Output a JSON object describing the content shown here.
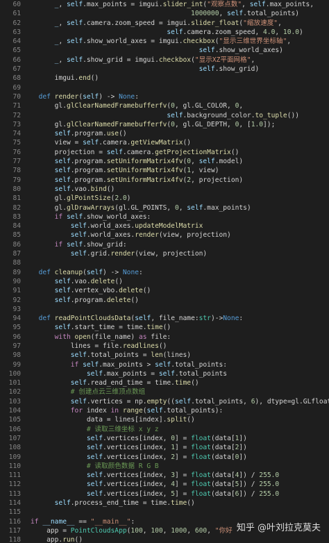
{
  "watermark": "知乎 @叶刘拉克莫夫",
  "lines": [
    {
      "n": "60",
      "html": "      <span class='self'>_</span>, <span class='self'>self</span>.max_points = imgui.<span class='fn'>slider_int</span>(<span class='str'>\"观察点数\"</span>, <span class='self'>self</span>.max_points,"
    },
    {
      "n": "61",
      "html": "                                        <span class='num'>1000000</span>, <span class='self'>self</span>.total_points)"
    },
    {
      "n": "62",
      "html": "      <span class='self'>_</span>, <span class='self'>self</span>.camera.zoom_speed = imgui.<span class='fn'>slider_float</span>(<span class='str'>\"缩放速度\"</span>,"
    },
    {
      "n": "63",
      "html": "                                  <span class='self'>self</span>.camera.zoom_speed, <span class='num'>4.0</span>, <span class='num'>10.0</span>)"
    },
    {
      "n": "64",
      "html": "      <span class='self'>_</span>, <span class='self'>self</span>.show_world_axes = imgui.<span class='fn'>checkbox</span>(<span class='str'>\"显示三维世界坐标轴\"</span>,"
    },
    {
      "n": "65",
      "html": "                                          <span class='self'>self</span>.show_world_axes)"
    },
    {
      "n": "66",
      "html": "      <span class='self'>_</span>, <span class='self'>self</span>.show_grid = imgui.<span class='fn'>checkbox</span>(<span class='str'>\"显示XZ平面网格\"</span>,"
    },
    {
      "n": "67",
      "html": "                                          <span class='self'>self</span>.show_grid)"
    },
    {
      "n": "68",
      "html": "      imgui.<span class='fn'>end</span>()"
    },
    {
      "n": "69",
      "html": ""
    },
    {
      "n": "70",
      "html": "  <span class='kw'>def</span> <span class='fn'>render</span>(<span class='self'>self</span>) -> <span class='kw'>None</span>:"
    },
    {
      "n": "71",
      "html": "      gl.<span class='fn'>glClearNamedFramebufferfv</span>(<span class='num'>0</span>, gl.GL_COLOR, <span class='num'>0</span>,"
    },
    {
      "n": "72",
      "html": "                                  <span class='self'>self</span>.background_color.<span class='fn'>to_tuple</span>())"
    },
    {
      "n": "73",
      "html": "      gl.<span class='fn'>glClearNamedFramebufferfv</span>(<span class='num'>0</span>, gl.GL_DEPTH, <span class='num'>0</span>, [<span class='num'>1.0</span>]);"
    },
    {
      "n": "74",
      "html": "      <span class='self'>self</span>.program.<span class='fn'>use</span>()"
    },
    {
      "n": "75",
      "html": "      view = <span class='self'>self</span>.camera.<span class='fn'>getViewMatrix</span>()"
    },
    {
      "n": "76",
      "html": "      projection = <span class='self'>self</span>.camera.<span class='fn'>getProjectionMatrix</span>()"
    },
    {
      "n": "77",
      "html": "      <span class='self'>self</span>.program.<span class='fn'>setUniformMatrix4fv</span>(<span class='num'>0</span>, <span class='self'>self</span>.model)"
    },
    {
      "n": "78",
      "html": "      <span class='self'>self</span>.program.<span class='fn'>setUniformMatrix4fv</span>(<span class='num'>1</span>, view)"
    },
    {
      "n": "79",
      "html": "      <span class='self'>self</span>.program.<span class='fn'>setUniformMatrix4fv</span>(<span class='num'>2</span>, projection)"
    },
    {
      "n": "80",
      "html": "      <span class='self'>self</span>.vao.<span class='fn'>bind</span>()"
    },
    {
      "n": "81",
      "html": "      gl.<span class='fn'>glPointSize</span>(<span class='num'>2.0</span>)"
    },
    {
      "n": "82",
      "html": "      gl.<span class='fn'>glDrawArrays</span>(gl.GL_POINTS, <span class='num'>0</span>, <span class='self'>self</span>.max_points)"
    },
    {
      "n": "83",
      "html": "      <span class='kw2'>if</span> <span class='self'>self</span>.show_world_axes:"
    },
    {
      "n": "84",
      "html": "          <span class='self'>self</span>.world_axes.<span class='fn'>updateModelMatrix</span>"
    },
    {
      "n": "85",
      "html": "          <span class='self'>self</span>.world_axes.<span class='fn'>render</span>(view, projection)"
    },
    {
      "n": "86",
      "html": "      <span class='kw2'>if</span> <span class='self'>self</span>.show_grid:"
    },
    {
      "n": "87",
      "html": "          <span class='self'>self</span>.grid.<span class='fn'>render</span>(view, projection)"
    },
    {
      "n": "88",
      "html": ""
    },
    {
      "n": "89",
      "html": "  <span class='kw'>def</span> <span class='fn'>cleanup</span>(<span class='self'>self</span>) -> <span class='kw'>None</span>:"
    },
    {
      "n": "90",
      "html": "      <span class='self'>self</span>.vao.<span class='fn'>delete</span>()"
    },
    {
      "n": "91",
      "html": "      <span class='self'>self</span>.vertex_vbo.<span class='fn'>delete</span>()"
    },
    {
      "n": "92",
      "html": "      <span class='self'>self</span>.program.<span class='fn'>delete</span>()"
    },
    {
      "n": "93",
      "html": ""
    },
    {
      "n": "94",
      "html": "  <span class='kw'>def</span> <span class='fn'>readPointCloudsData</span>(<span class='self'>self</span>, file_name:<span class='cls'>str</span>)-><span class='kw'>None</span>:"
    },
    {
      "n": "95",
      "html": "      <span class='self'>self</span>.start_time = time.<span class='fn'>time</span>()"
    },
    {
      "n": "96",
      "html": "      <span class='kw2'>with</span> <span class='fn'>open</span>(file_name) <span class='kw2'>as</span> file:"
    },
    {
      "n": "97",
      "html": "          lines = file.<span class='fn'>readlines</span>()"
    },
    {
      "n": "98",
      "html": "          <span class='self'>self</span>.total_points = <span class='fn'>len</span>(lines)"
    },
    {
      "n": "99",
      "html": "          <span class='kw2'>if</span> <span class='self'>self</span>.max_points > <span class='self'>self</span>.total_points:"
    },
    {
      "n": "100",
      "html": "              <span class='self'>self</span>.max_points = <span class='self'>self</span>.total_points"
    },
    {
      "n": "101",
      "html": "          <span class='self'>self</span>.read_end_time = time.<span class='fn'>time</span>()"
    },
    {
      "n": "102",
      "html": "          <span class='cm'># 创建点云三维顶点数组</span>"
    },
    {
      "n": "103",
      "html": "          <span class='self'>self</span>.vertices = np.<span class='fn'>empty</span>((<span class='self'>self</span>.total_points, <span class='num'>6</span>), dtype=gl.GLfloat)"
    },
    {
      "n": "104",
      "html": "          <span class='kw2'>for</span> index <span class='kw2'>in</span> <span class='fn'>range</span>(<span class='self'>self</span>.total_points):"
    },
    {
      "n": "105",
      "html": "              data = lines[index].<span class='fn'>split</span>()"
    },
    {
      "n": "106",
      "html": "              <span class='cm'># 读取三维坐标 x y z</span>"
    },
    {
      "n": "107",
      "html": "              <span class='self'>self</span>.vertices[index, <span class='num'>0</span>] = <span class='cls'>float</span>(data[<span class='num'>1</span>])"
    },
    {
      "n": "108",
      "html": "              <span class='self'>self</span>.vertices[index, <span class='num'>1</span>] = <span class='cls'>float</span>(data[<span class='num'>2</span>])"
    },
    {
      "n": "109",
      "html": "              <span class='self'>self</span>.vertices[index, <span class='num'>2</span>] = <span class='cls'>float</span>(data[<span class='num'>0</span>])"
    },
    {
      "n": "110",
      "html": "              <span class='cm'># 读取颜色数据 R G B</span>"
    },
    {
      "n": "111",
      "html": "              <span class='self'>self</span>.vertices[index, <span class='num'>3</span>] = <span class='cls'>float</span>(data[<span class='num'>4</span>]) / <span class='num'>255.0</span>"
    },
    {
      "n": "112",
      "html": "              <span class='self'>self</span>.vertices[index, <span class='num'>4</span>] = <span class='cls'>float</span>(data[<span class='num'>5</span>]) / <span class='num'>255.0</span>"
    },
    {
      "n": "113",
      "html": "              <span class='self'>self</span>.vertices[index, <span class='num'>5</span>] = <span class='cls'>float</span>(data[<span class='num'>6</span>]) / <span class='num'>255.0</span>"
    },
    {
      "n": "114",
      "html": "      <span class='self'>self</span>.process_end_time = time.<span class='fn'>time</span>()"
    },
    {
      "n": "115",
      "html": ""
    },
    {
      "n": "116",
      "html": "<span class='kw2'>if</span> <span class='self'>__name__</span> == <span class='str'>\"__main__\"</span>:"
    },
    {
      "n": "117",
      "html": "    app = <span class='cls'>PointCloudsApp</span>(<span class='num'>100</span>, <span class='num'>100</span>, <span class='num'>1000</span>, <span class='num'>600</span>, <span class='str'>\"你好</span>"
    },
    {
      "n": "118",
      "html": "    app.<span class='fn'>run</span>()"
    }
  ]
}
